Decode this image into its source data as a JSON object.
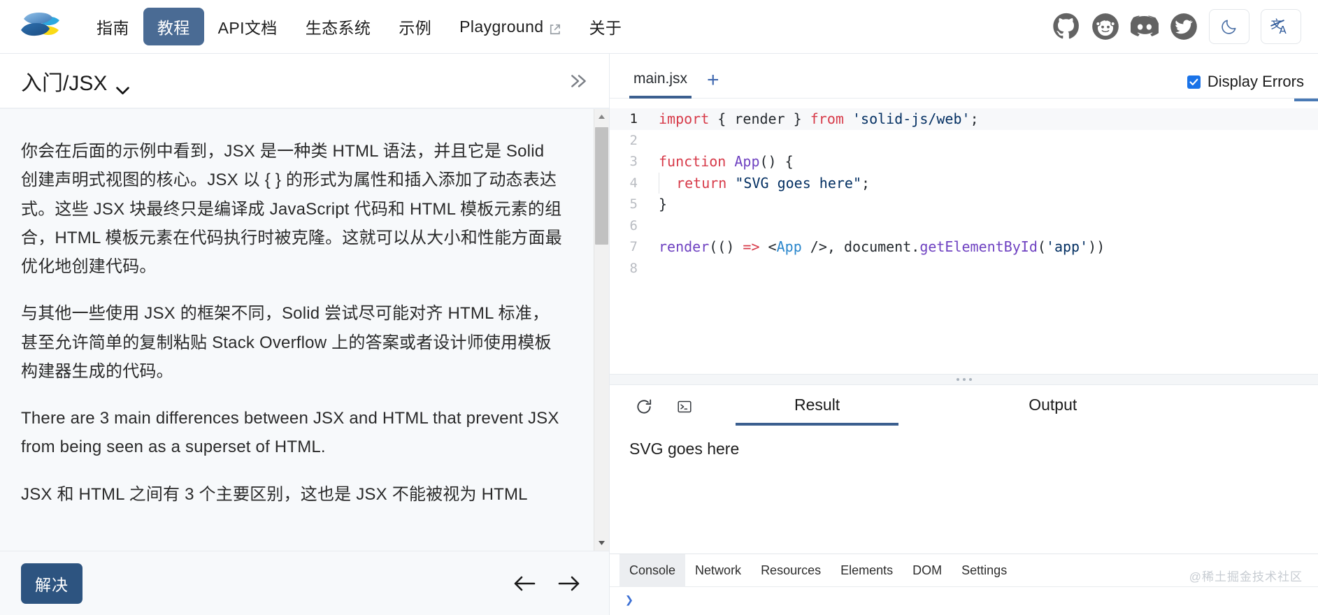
{
  "header": {
    "logo_name": "solid-js-logo",
    "nav": [
      {
        "label": "指南",
        "active": false,
        "external": false
      },
      {
        "label": "教程",
        "active": true,
        "external": false
      },
      {
        "label": "API文档",
        "active": false,
        "external": false
      },
      {
        "label": "生态系统",
        "active": false,
        "external": false
      },
      {
        "label": "示例",
        "active": false,
        "external": false
      },
      {
        "label": "Playground",
        "active": false,
        "external": true
      },
      {
        "label": "关于",
        "active": false,
        "external": false
      }
    ],
    "social": [
      {
        "name": "github-icon"
      },
      {
        "name": "reddit-icon"
      },
      {
        "name": "discord-icon"
      },
      {
        "name": "twitter-icon"
      }
    ],
    "theme_toggle": "moon-icon",
    "language_toggle": "translate-icon",
    "active_accent": "#4a6b94"
  },
  "lesson": {
    "title": "入门/JSX",
    "dropdown_icon": "chevron-down-icon",
    "collapse_icon": "double-chevron-right-icon",
    "paragraphs": [
      "你会在后面的示例中看到，JSX 是一种类 HTML 语法，并且它是 Solid 创建声明式视图的核心。JSX 以 { } 的形式为属性和插入添加了动态表达式。这些 JSX 块最终只是编译成 JavaScript 代码和 HTML 模板元素的组合，HTML 模板元素在代码执行时被克隆。这就可以从大小和性能方面最优化地创建代码。",
      "与其他一些使用 JSX 的框架不同，Solid 尝试尽可能对齐 HTML 标准，甚至允许简单的复制粘贴 Stack Overflow 上的答案或者设计师使用模板构建器生成的代码。",
      "There are 3 main differences between JSX and HTML that prevent JSX from being seen as a superset of HTML.",
      "JSX 和 HTML 之间有 3 个主要区别，这也是 JSX 不能被视为 HTML"
    ],
    "solve_button": "解决",
    "prev_icon": "arrow-left-icon",
    "next_icon": "arrow-right-icon"
  },
  "editor": {
    "tabs": [
      {
        "label": "main.jsx",
        "active": true
      }
    ],
    "add_tab_label": "+",
    "display_errors": {
      "label": "Display Errors",
      "checked": true
    },
    "accent_color": "#3b5f8f",
    "lines": [
      {
        "n": "1",
        "current": true,
        "tokens": [
          {
            "t": "import",
            "c": "kw"
          },
          {
            "t": " ",
            "c": "plain"
          },
          {
            "t": "{",
            "c": "punc"
          },
          {
            "t": " render ",
            "c": "plain"
          },
          {
            "t": "}",
            "c": "punc"
          },
          {
            "t": " ",
            "c": "plain"
          },
          {
            "t": "from",
            "c": "kw"
          },
          {
            "t": " ",
            "c": "plain"
          },
          {
            "t": "'solid-js/web'",
            "c": "str"
          },
          {
            "t": ";",
            "c": "punc"
          }
        ]
      },
      {
        "n": "2",
        "current": false,
        "tokens": []
      },
      {
        "n": "3",
        "current": false,
        "tokens": [
          {
            "t": "function",
            "c": "kw"
          },
          {
            "t": " ",
            "c": "plain"
          },
          {
            "t": "App",
            "c": "fn"
          },
          {
            "t": "() {",
            "c": "punc"
          }
        ]
      },
      {
        "n": "4",
        "current": false,
        "indent": true,
        "tokens": [
          {
            "t": "  ",
            "c": "plain"
          },
          {
            "t": "return",
            "c": "kw"
          },
          {
            "t": " ",
            "c": "plain"
          },
          {
            "t": "\"SVG goes here\"",
            "c": "str"
          },
          {
            "t": ";",
            "c": "punc"
          }
        ]
      },
      {
        "n": "5",
        "current": false,
        "tokens": [
          {
            "t": "}",
            "c": "punc"
          }
        ]
      },
      {
        "n": "6",
        "current": false,
        "tokens": []
      },
      {
        "n": "7",
        "current": false,
        "tokens": [
          {
            "t": "render",
            "c": "fn"
          },
          {
            "t": "(() ",
            "c": "punc"
          },
          {
            "t": "=>",
            "c": "arrow-op"
          },
          {
            "t": " <",
            "c": "punc"
          },
          {
            "t": "App",
            "c": "tag"
          },
          {
            "t": " />, document.",
            "c": "punc"
          },
          {
            "t": "getElementById",
            "c": "fn"
          },
          {
            "t": "(",
            "c": "punc"
          },
          {
            "t": "'app'",
            "c": "str"
          },
          {
            "t": "))",
            "c": "punc"
          }
        ]
      },
      {
        "n": "8",
        "current": false,
        "tokens": []
      }
    ]
  },
  "result_panel": {
    "refresh_icon": "refresh-icon",
    "console_icon": "terminal-icon",
    "tabs": [
      {
        "label": "Result",
        "selected": true
      },
      {
        "label": "Output",
        "selected": false
      }
    ],
    "output_text": "SVG goes here"
  },
  "devtools": {
    "tabs": [
      {
        "label": "Console",
        "selected": true
      },
      {
        "label": "Network",
        "selected": false
      },
      {
        "label": "Resources",
        "selected": false
      },
      {
        "label": "Elements",
        "selected": false
      },
      {
        "label": "DOM",
        "selected": false
      },
      {
        "label": "Settings",
        "selected": false
      }
    ],
    "prompt": "❯",
    "watermark": "@稀土掘金技术社区"
  }
}
